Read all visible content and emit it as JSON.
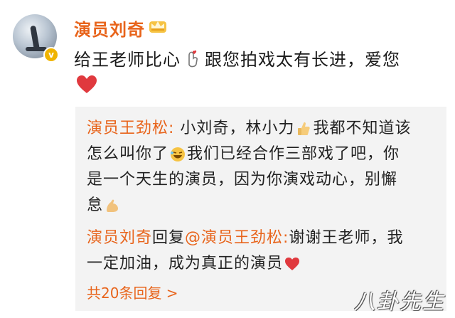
{
  "post": {
    "author": "演员刘奇",
    "text_part1": "给王老师比心",
    "text_part2": "跟您拍戏太有长进，爱您"
  },
  "replies": {
    "reply1": {
      "author": "演员王劲松:",
      "line1_text_a": "小刘奇，林小力",
      "line1_text_b": "我都不知道该",
      "line2_text_a": "怎么叫你了",
      "line2_text_b": "我们已经合作三部戏了吧，你",
      "line3": "是一个天生的演员，因为你演戏动心，别懈",
      "line4": "怠"
    },
    "reply2": {
      "author": "演员刘奇",
      "reply_word": "回复",
      "mention": "@演员王劲松:",
      "line1_text": "谢谢王老师，我",
      "line2_text": "一定加油，成为真正的演员"
    },
    "more_label": "共20条回复 >"
  },
  "watermark": "八卦先生",
  "colors": {
    "accent": "#e8641b",
    "heart": "#e0393e",
    "reply_bg": "#f3f3f3"
  },
  "icons": [
    "crown-icon",
    "verified-icon",
    "finger-heart-icon",
    "heart-icon",
    "thumbs-up-icon",
    "laughing-emoji-icon",
    "flexed-biceps-icon"
  ]
}
